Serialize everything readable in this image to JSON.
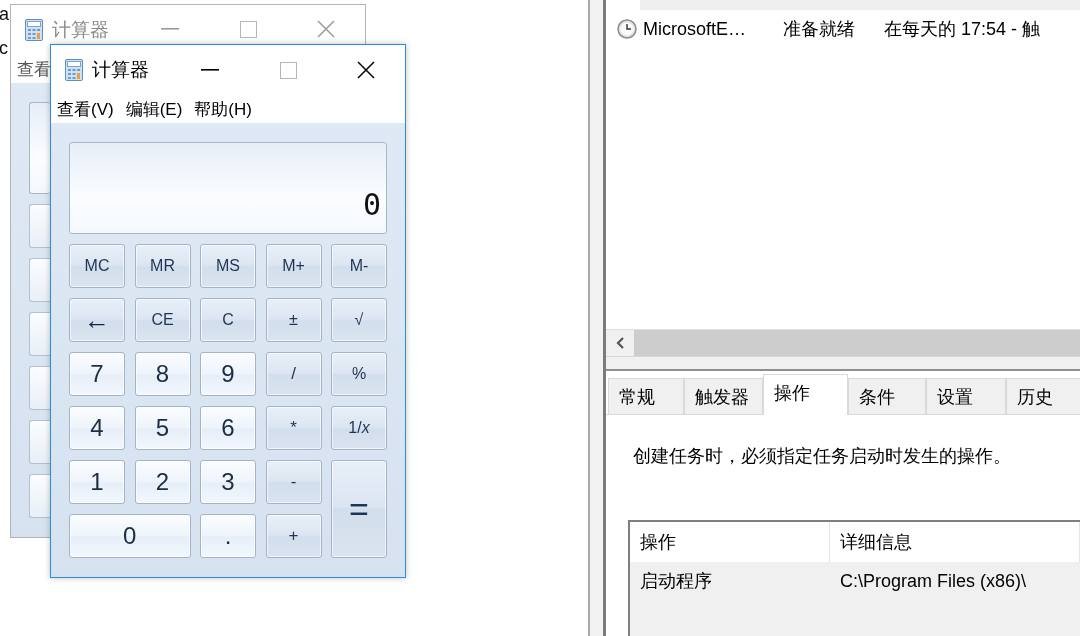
{
  "desktop_fragments": [
    "a",
    "c"
  ],
  "calculator_windows": [
    {
      "title": "计算器",
      "active": false,
      "menu": [
        "查看"
      ]
    },
    {
      "title": "计算器",
      "active": true,
      "menu": [
        "查看(V)",
        "编辑(E)",
        "帮助(H)"
      ],
      "display": "0",
      "keys": [
        {
          "label": "MC",
          "kind": "memory"
        },
        {
          "label": "MR",
          "kind": "memory"
        },
        {
          "label": "MS",
          "kind": "memory"
        },
        {
          "label": "M+",
          "kind": "memory"
        },
        {
          "label": "M-",
          "kind": "memory"
        },
        {
          "label": "←",
          "kind": "backspace"
        },
        {
          "label": "CE",
          "kind": "function"
        },
        {
          "label": "C",
          "kind": "function"
        },
        {
          "label": "±",
          "kind": "function"
        },
        {
          "label": "√",
          "kind": "function"
        },
        {
          "label": "7",
          "kind": "digit"
        },
        {
          "label": "8",
          "kind": "digit"
        },
        {
          "label": "9",
          "kind": "digit"
        },
        {
          "label": "/",
          "kind": "operator"
        },
        {
          "label": "%",
          "kind": "function"
        },
        {
          "label": "4",
          "kind": "digit"
        },
        {
          "label": "5",
          "kind": "digit"
        },
        {
          "label": "6",
          "kind": "digit"
        },
        {
          "label": "*",
          "kind": "operator"
        },
        {
          "label": "1/*x*",
          "kind": "function"
        },
        {
          "label": "1",
          "kind": "digit"
        },
        {
          "label": "2",
          "kind": "digit"
        },
        {
          "label": "3",
          "kind": "digit"
        },
        {
          "label": "-",
          "kind": "operator"
        },
        {
          "label": "=",
          "kind": "equals"
        },
        {
          "label": "0",
          "kind": "wide-digit"
        },
        {
          "label": ".",
          "kind": "digit"
        },
        {
          "label": "+",
          "kind": "operator"
        }
      ]
    }
  ],
  "task_scheduler": {
    "tasks": [
      {
        "name": "MicrosoftE…",
        "status": "准备就绪",
        "trigger": "在每天的 17:54 - 触"
      }
    ],
    "tabs": [
      {
        "label": "常规",
        "selected": false
      },
      {
        "label": "触发器",
        "selected": false
      },
      {
        "label": "操作",
        "selected": true
      },
      {
        "label": "条件",
        "selected": false
      },
      {
        "label": "设置",
        "selected": false
      },
      {
        "label": "历史",
        "selected": false
      }
    ],
    "description": "创建任务时，必须指定任务启动时发生的操作。",
    "actions_table": {
      "columns": [
        "操作",
        "详细信息"
      ],
      "rows": [
        [
          "启动程序",
          "C:\\Program Files (x86)\\"
        ]
      ]
    }
  }
}
